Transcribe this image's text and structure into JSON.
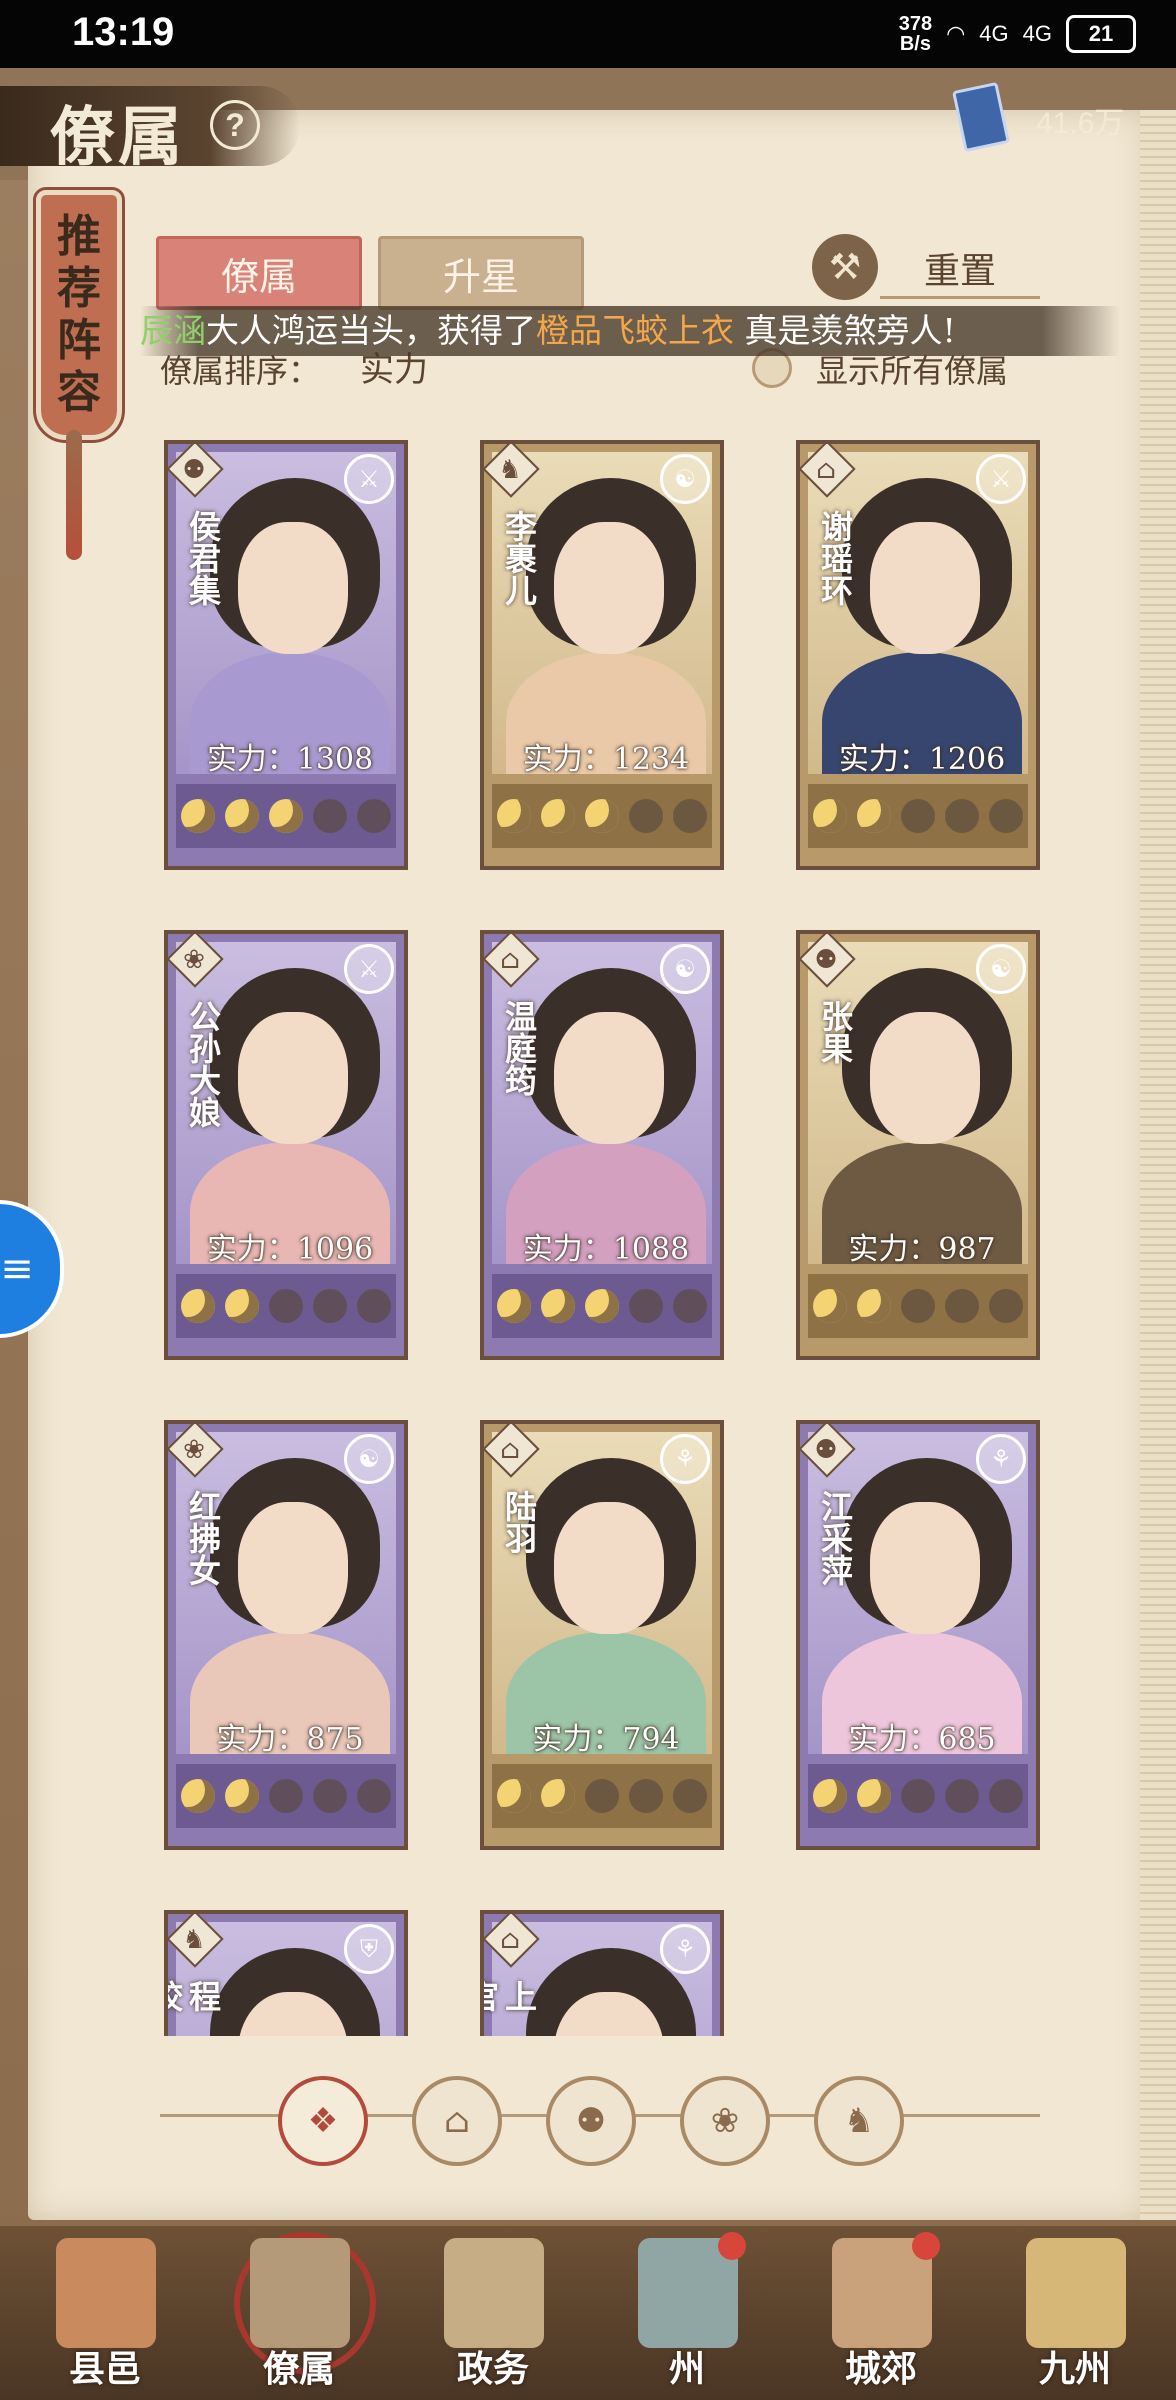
{
  "status_bar": {
    "time": "13:19",
    "net_speed_value": "378",
    "net_speed_unit": "B/s",
    "signal1": "4G",
    "signal2": "4G",
    "battery": "21"
  },
  "header": {
    "title": "僚属",
    "currency_value": "41.6万"
  },
  "bookmark": {
    "label": "推荐阵容"
  },
  "tabs": [
    {
      "label": "僚属",
      "active": true
    },
    {
      "label": "升星",
      "active": false
    }
  ],
  "reset_label": "重置",
  "broadcast": {
    "name": "辰涵",
    "text1": "大人鸿运当头，获得了",
    "item": "橙品飞蛟上衣",
    "text2": "真是羡煞旁人!"
  },
  "sort": {
    "label": "僚属排序：",
    "value": "实力"
  },
  "show_all_label": "显示所有僚属",
  "power_prefix": "实力：",
  "colors": {
    "purple_card": "#8c7ab0",
    "gold_card": "#b89a6a",
    "active_tab": "#d98278",
    "accent_red": "#b44a3c"
  },
  "cards": [
    {
      "name": "侯君集",
      "power": "1308",
      "stars": 3,
      "theme": "purple",
      "class_icon": "gourd-icon",
      "role_icon": "sword-icon"
    },
    {
      "name": "李裹儿",
      "power": "1234",
      "stars": 3,
      "theme": "gold",
      "class_icon": "horse-icon",
      "role_icon": "taiji-icon"
    },
    {
      "name": "谢瑶环",
      "power": "1206",
      "stars": 2,
      "theme": "gold",
      "class_icon": "hat-icon",
      "role_icon": "sword-icon"
    },
    {
      "name": "公孙大娘",
      "power": "1096",
      "stars": 2,
      "theme": "purple",
      "class_icon": "fan-icon",
      "role_icon": "sword-icon"
    },
    {
      "name": "温庭筠",
      "power": "1088",
      "stars": 3,
      "theme": "purple",
      "class_icon": "hat-icon",
      "role_icon": "taiji-icon"
    },
    {
      "name": "张果",
      "power": "987",
      "stars": 2,
      "theme": "gold",
      "class_icon": "gourd-icon",
      "role_icon": "taiji-icon"
    },
    {
      "name": "红拂女",
      "power": "875",
      "stars": 2,
      "theme": "purple",
      "class_icon": "fan-icon",
      "role_icon": "taiji-icon"
    },
    {
      "name": "陆羽",
      "power": "794",
      "stars": 2,
      "theme": "gold",
      "class_icon": "hat-icon",
      "role_icon": "shell-icon"
    },
    {
      "name": "江采萍",
      "power": "685",
      "stars": 2,
      "theme": "purple",
      "class_icon": "gourd-icon",
      "role_icon": "shell-icon"
    },
    {
      "name": "程咬",
      "power": "",
      "stars": 0,
      "theme": "purple",
      "class_icon": "horse-icon",
      "role_icon": "shield-icon"
    },
    {
      "name": "上官",
      "power": "",
      "stars": 0,
      "theme": "purple",
      "class_icon": "hat-icon",
      "role_icon": "shell-icon"
    }
  ],
  "filters": [
    "all-filter-icon",
    "hat-filter-icon",
    "gourd-filter-icon",
    "fan-filter-icon",
    "horse-filter-icon"
  ],
  "bottom_nav": [
    {
      "label": "县邑",
      "icon": "county-icon",
      "active": false,
      "dot": false
    },
    {
      "label": "僚属",
      "icon": "retainer-icon",
      "active": true,
      "dot": false
    },
    {
      "label": "政务",
      "icon": "affairs-icon",
      "active": false,
      "dot": false
    },
    {
      "label": "州",
      "icon": "prefecture-icon",
      "active": false,
      "dot": true
    },
    {
      "label": "城郊",
      "icon": "suburb-icon",
      "active": false,
      "dot": true
    },
    {
      "label": "九州",
      "icon": "map-icon",
      "active": false,
      "dot": false
    }
  ]
}
